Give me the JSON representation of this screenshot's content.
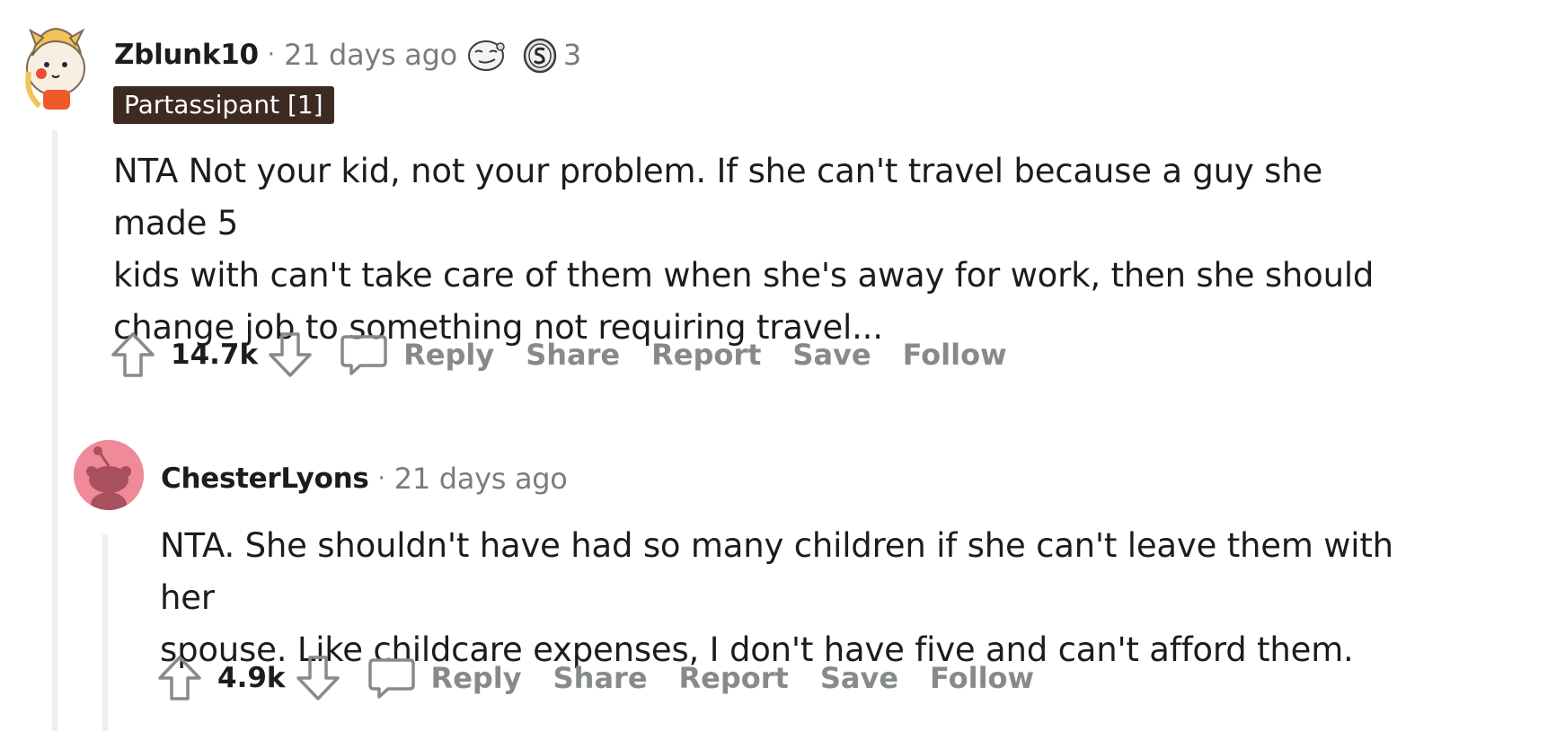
{
  "comments": [
    {
      "username": "Zblunk10",
      "separator": "·",
      "timestamp": "21 days ago",
      "award_count": "3",
      "flair": "Partassipant [1]",
      "body_lines": [
        "NTA Not your kid, not your problem. If she can't travel because a guy she made 5",
        "kids with can't take care of them when she's away for work, then she should",
        "change job to something not requiring travel..."
      ],
      "score": "14.7k",
      "actions": {
        "reply": "Reply",
        "share": "Share",
        "report": "Report",
        "save": "Save",
        "follow": "Follow"
      },
      "avatar_icon": "snoo-custom-avatar-icon"
    },
    {
      "username": "ChesterLyons",
      "separator": "·",
      "timestamp": "21 days ago",
      "body_lines": [
        "NTA. She shouldn't have had so many children if she can't leave them with her",
        "spouse. Like childcare expenses, I don't have five and can't afford them."
      ],
      "score": "4.9k",
      "actions": {
        "reply": "Reply",
        "share": "Share",
        "report": "Report",
        "save": "Save",
        "follow": "Follow"
      },
      "avatar_icon": "snoo-default-avatar-icon"
    }
  ],
  "colors": {
    "meta_gray": "#7c7c7c",
    "action_gray": "#878a8c",
    "flair_bg": "#3d2b22",
    "thread_line": "#edeff1",
    "avatar_pink": "#f08a98"
  }
}
